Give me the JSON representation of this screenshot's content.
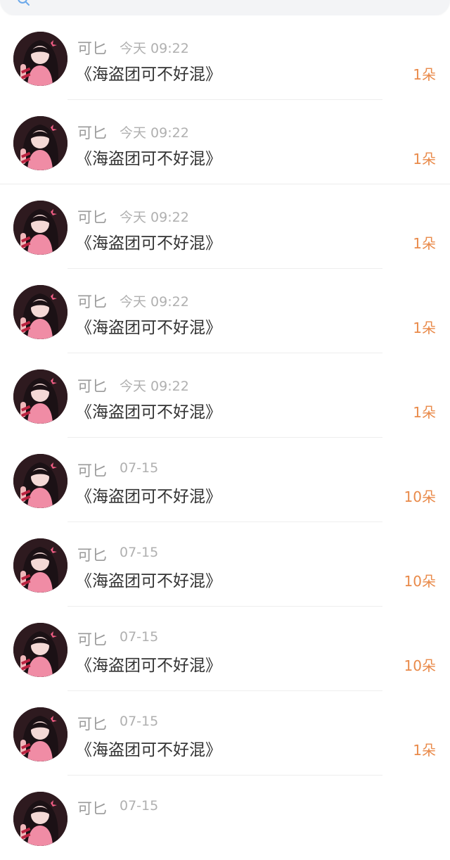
{
  "search": {
    "icon": "search-icon"
  },
  "list": {
    "items": [
      {
        "name": "可匕",
        "time": "今天 09:22",
        "title": "《海盗团可不好混》",
        "amount": "1朵"
      },
      {
        "name": "可匕",
        "time": "今天 09:22",
        "title": "《海盗团可不好混》",
        "amount": "1朵"
      },
      {
        "name": "可匕",
        "time": "今天 09:22",
        "title": "《海盗团可不好混》",
        "amount": "1朵"
      },
      {
        "name": "可匕",
        "time": "今天 09:22",
        "title": "《海盗团可不好混》",
        "amount": "1朵"
      },
      {
        "name": "可匕",
        "time": "今天 09:22",
        "title": "《海盗团可不好混》",
        "amount": "1朵"
      },
      {
        "name": "可匕",
        "time": "07-15",
        "title": "《海盗团可不好混》",
        "amount": "10朵"
      },
      {
        "name": "可匕",
        "time": "07-15",
        "title": "《海盗团可不好混》",
        "amount": "10朵"
      },
      {
        "name": "可匕",
        "time": "07-15",
        "title": "《海盗团可不好混》",
        "amount": "10朵"
      },
      {
        "name": "可匕",
        "time": "07-15",
        "title": "《海盗团可不好混》",
        "amount": "1朵"
      },
      {
        "name": "可匕",
        "time": "07-15",
        "title": "",
        "amount": ""
      }
    ]
  },
  "colors": {
    "amount": "#e98a4a",
    "name": "#9a9a9a",
    "time": "#b0b0b0",
    "title": "#333333"
  }
}
